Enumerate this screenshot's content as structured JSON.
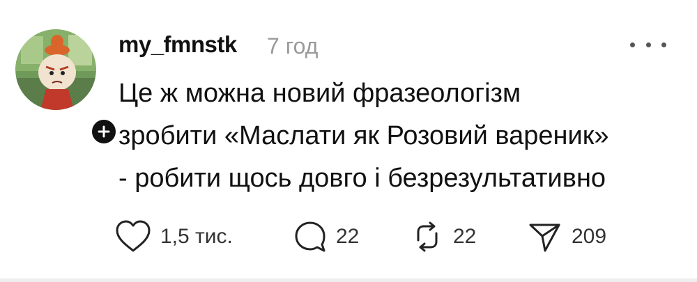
{
  "post": {
    "username": "my_fmnstk",
    "time": "7 год",
    "text_lines": [
      "Це ж можна новий фразеологізм",
      "зробити «Маслати як Розовий вареник»",
      "- робити щось довго і безрезультативно"
    ]
  },
  "actions": {
    "likes": "1,5 тис.",
    "comments": "22",
    "reposts": "22",
    "shares": "209"
  },
  "icons": {
    "avatar": "avatar-icon",
    "follow": "plus-icon",
    "more": "more-horizontal-icon",
    "like": "heart-icon",
    "comment": "comment-icon",
    "repost": "repost-icon",
    "share": "send-icon"
  },
  "colors": {
    "text": "#111111",
    "muted": "#9a9a9a",
    "badge": "#111111"
  }
}
